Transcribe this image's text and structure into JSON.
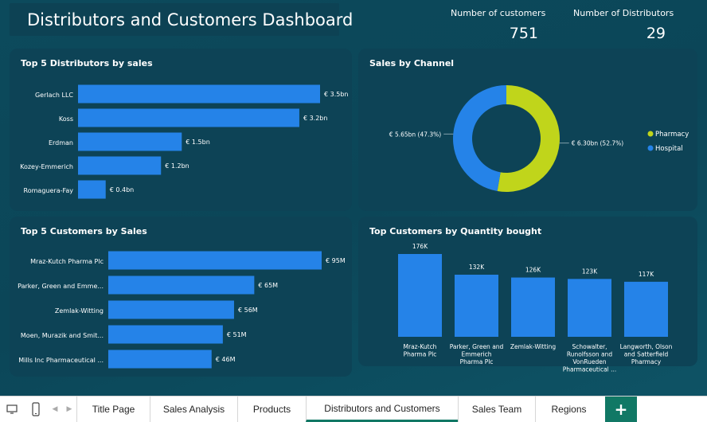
{
  "header": {
    "title": "Distributors and Customers Dashboard",
    "kpi_customers_label": "Number of customers",
    "kpi_customers_value": "751",
    "kpi_distributors_label": "Number of Distributors",
    "kpi_distributors_value": "29"
  },
  "colors": {
    "bar": "#2583e8",
    "pharmacy": "#c0d51b",
    "hospital": "#2583e8",
    "card": "#0d4356",
    "accent_tab": "#117865"
  },
  "chart_data": [
    {
      "id": "top-distributors",
      "type": "bar",
      "orientation": "horizontal",
      "title": "Top 5 Distributors by sales",
      "categories": [
        "Gerlach LLC",
        "Koss",
        "Erdman",
        "Kozey-Emmerich",
        "Romaguera-Fay"
      ],
      "values": [
        3.5,
        3.2,
        1.5,
        1.2,
        0.4
      ],
      "labels": [
        "€ 3.5bn",
        "€ 3.2bn",
        "€ 1.5bn",
        "€ 1.2bn",
        "€ 0.4bn"
      ],
      "unit": "€ bn"
    },
    {
      "id": "sales-by-channel",
      "type": "pie",
      "style": "donut",
      "title": "Sales by Channel",
      "categories": [
        "Pharmacy",
        "Hospital"
      ],
      "values": [
        6.3,
        5.65
      ],
      "percents": [
        52.7,
        47.3
      ],
      "labels": [
        "€ 6.30bn (52.7%)",
        "€ 5.65bn (47.3%)"
      ],
      "legend": "right"
    },
    {
      "id": "top-customers-sales",
      "type": "bar",
      "orientation": "horizontal",
      "title": "Top 5 Customers by Sales",
      "categories": [
        "Mraz-Kutch Pharma Plc",
        "Parker, Green and Emme...",
        "Zemlak-Witting",
        "Moen, Murazik and Smit...",
        "Mills Inc Pharmaceutical ..."
      ],
      "values": [
        95,
        65,
        56,
        51,
        46
      ],
      "labels": [
        "€ 95M",
        "€ 65M",
        "€ 56M",
        "€ 51M",
        "€ 46M"
      ],
      "unit": "€ M"
    },
    {
      "id": "top-customers-qty",
      "type": "bar",
      "orientation": "vertical",
      "title": "Top Customers by Quantity bought",
      "categories": [
        [
          "Mraz-Kutch",
          "Pharma Plc"
        ],
        [
          "Parker, Green and",
          "Emmerich",
          "Pharma Plc"
        ],
        [
          "Zemlak-Witting"
        ],
        [
          "Schowalter,",
          "Runolfsson and",
          "VonRueden",
          "Pharmaceutical ..."
        ],
        [
          "Langworth, Olson",
          "and Satterfield",
          "Pharmacy"
        ]
      ],
      "values": [
        176,
        132,
        126,
        123,
        117
      ],
      "labels": [
        "176K",
        "132K",
        "126K",
        "123K",
        "117K"
      ],
      "unit": "K"
    }
  ],
  "tabs": [
    {
      "label": "Title Page",
      "active": false
    },
    {
      "label": "Sales Analysis",
      "active": false
    },
    {
      "label": "Products",
      "active": false
    },
    {
      "label": "Distributors and Customers",
      "active": true
    },
    {
      "label": "Sales Team",
      "active": false
    },
    {
      "label": "Regions",
      "active": false
    }
  ],
  "tab_add_label": "+"
}
